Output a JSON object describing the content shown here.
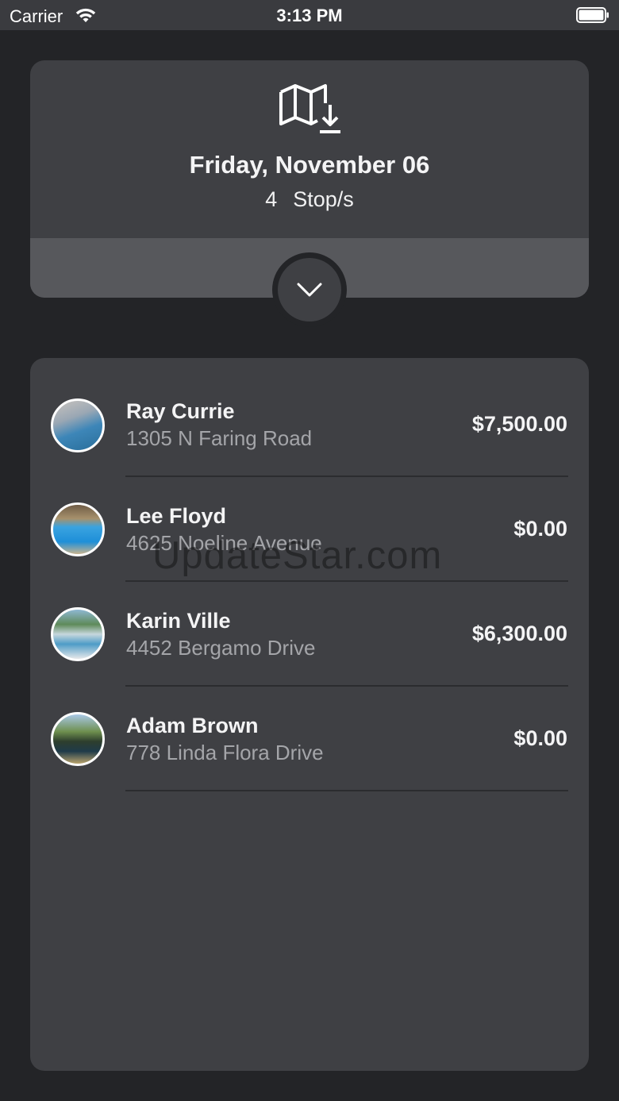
{
  "status_bar": {
    "carrier": "Carrier",
    "time": "3:13 PM",
    "wifi_icon": "wifi-icon",
    "battery_icon": "battery-icon"
  },
  "summary": {
    "icon": "map-download-icon",
    "date": "Friday, November 06",
    "stop_count": "4",
    "stop_label": "Stop/s",
    "expand_icon": "chevron-down-icon"
  },
  "stops": [
    {
      "name": "Ray Currie",
      "address": "1305 N Faring Road",
      "amount": "$7,500.00",
      "avatar": "pool-photo-avatar"
    },
    {
      "name": "Lee Floyd",
      "address": "4625 Noeline Avenue",
      "amount": "$0.00",
      "avatar": "pool-photo-avatar"
    },
    {
      "name": "Karin Ville",
      "address": "4452 Bergamo Drive",
      "amount": "$6,300.00",
      "avatar": "pool-photo-avatar"
    },
    {
      "name": "Adam Brown",
      "address": "778 Linda Flora Drive",
      "amount": "$0.00",
      "avatar": "pool-photo-avatar"
    }
  ],
  "watermark": "UpdateStar.com",
  "colors": {
    "background": "#232427",
    "card": "#3f4044",
    "card_footer": "#57585c",
    "primary_text": "#f4f4f5",
    "secondary_text": "#a4a5a9"
  }
}
